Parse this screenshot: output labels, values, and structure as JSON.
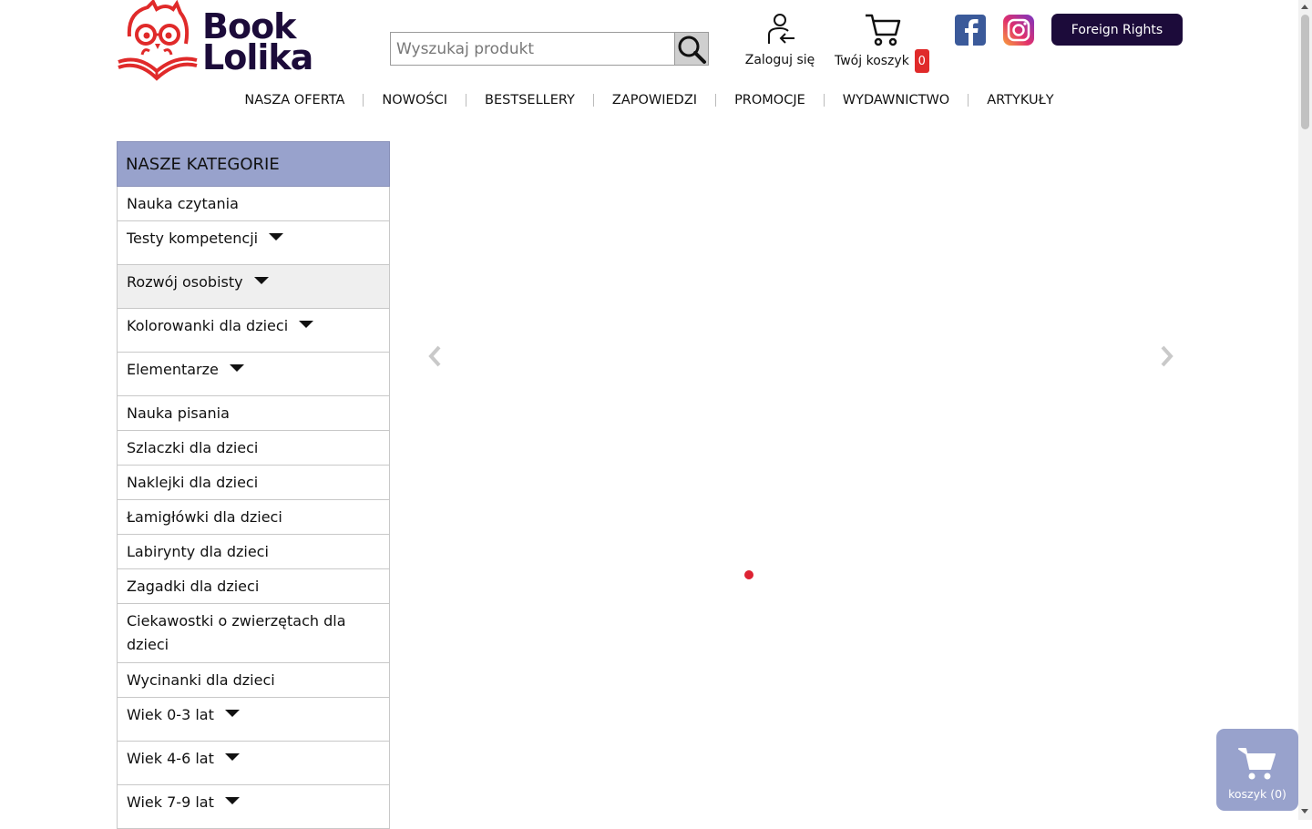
{
  "brand": {
    "logo_line1": "Book",
    "logo_line2": "Lolika",
    "color": "#1c0b3a",
    "accent": "#e02a2a"
  },
  "search": {
    "placeholder": "Wyszukaj produkt",
    "value": ""
  },
  "header": {
    "login_label": "Zaloguj się",
    "cart_label": "Twój koszyk",
    "cart_count": "0",
    "foreign_rights_label": "Foreign Rights"
  },
  "nav": [
    "NASZA OFERTA",
    "NOWOŚCI",
    "BESTSELLERY",
    "ZAPOWIEDZI",
    "PROMOCJE",
    "WYDAWNICTWO",
    "ARTYKUŁY"
  ],
  "sidebar": {
    "title": "NASZE KATEGORIE",
    "items": [
      {
        "label": "Nauka czytania"
      },
      {
        "label": "Testy kompetencji"
      },
      {
        "label": "Rozwój osobisty"
      },
      {
        "label": "Kolorowanki dla dzieci"
      },
      {
        "label": "Elementarze"
      },
      {
        "label": "Nauka pisania"
      },
      {
        "label": "Szlaczki dla dzieci"
      },
      {
        "label": "Naklejki dla dzieci"
      },
      {
        "label": "Łamigłówki dla dzieci"
      },
      {
        "label": "Labirynty dla dzieci"
      },
      {
        "label": "Zagadki dla dzieci"
      },
      {
        "label": "Ciekawostki o zwierzętach dla dzieci"
      },
      {
        "label": "Wycinanki dla dzieci"
      },
      {
        "label": "Wiek 0-3 lat"
      },
      {
        "label": "Wiek 4-6 lat"
      },
      {
        "label": "Wiek 7-9 lat"
      }
    ]
  },
  "floating_cart": {
    "label": "koszyk (0)"
  },
  "icons": {
    "search": "search-icon",
    "login": "user-login-icon",
    "cart": "cart-icon",
    "facebook": "facebook-icon",
    "instagram": "instagram-icon",
    "prev": "chevron-left-icon",
    "next": "chevron-right-icon",
    "caret": "caret-down-icon"
  }
}
